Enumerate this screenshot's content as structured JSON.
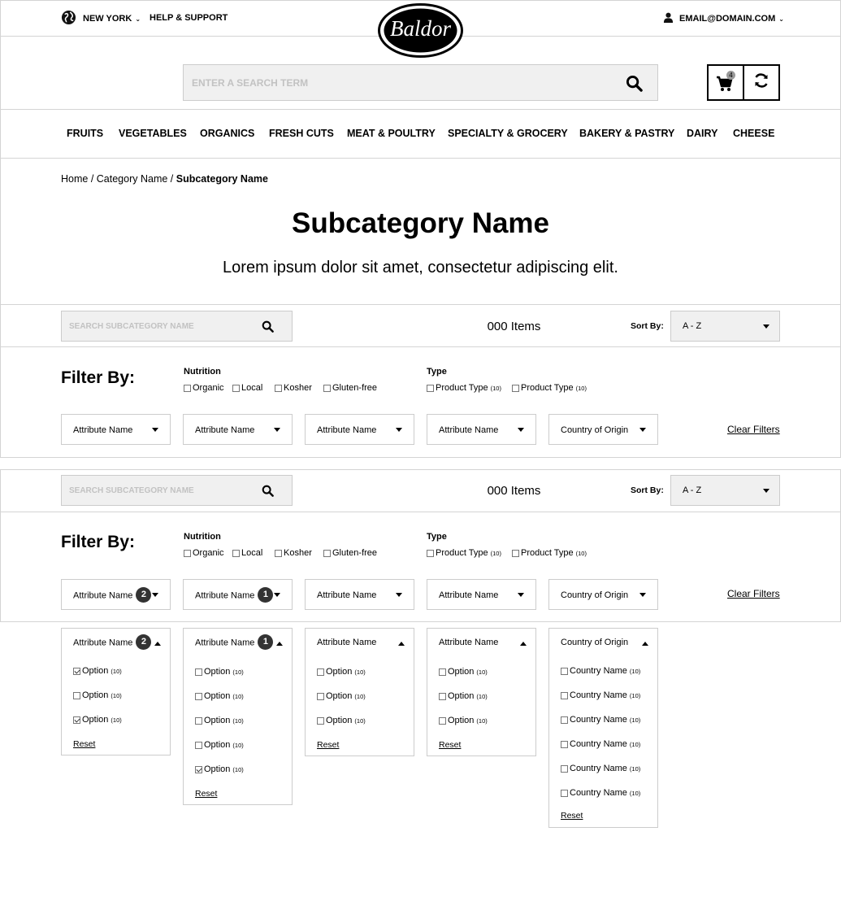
{
  "header": {
    "location": "NEW YORK",
    "help": "HELP & SUPPORT",
    "logo": "Baldor",
    "account": "EMAIL@DOMAIN.COM",
    "search_placeholder": "ENTER A SEARCH TERM",
    "cart_count": "4"
  },
  "nav": [
    "FRUITS",
    "VEGETABLES",
    "ORGANICS",
    "FRESH CUTS",
    "MEAT & POULTRY",
    "SPECIALTY & GROCERY",
    "BAKERY & PASTRY",
    "DAIRY",
    "CHEESE"
  ],
  "breadcrumb": {
    "home": "Home",
    "category": "Category Name",
    "current": "Subcategory Name",
    "sep": " / "
  },
  "page": {
    "title": "Subcategory Name",
    "subtitle": "Lorem ipsum dolor sit amet, consectetur adipiscing elit."
  },
  "toolbar": {
    "search_placeholder": "SEARCH SUBCATEGORY NAME",
    "items_count": "000 Items",
    "sort_label": "Sort By:",
    "sort_value": "A - Z"
  },
  "filters": {
    "title": "Filter By:",
    "nutrition_label": "Nutrition",
    "nutrition": [
      "Organic",
      "Local",
      "Kosher",
      "Gluten-free"
    ],
    "type_label": "Type",
    "types": [
      {
        "label": "Product Type",
        "count": "(10)"
      },
      {
        "label": "Product Type",
        "count": "(10)"
      }
    ],
    "clear": "Clear Filters",
    "selects": [
      "Attribute Name",
      "Attribute Name",
      "Attribute Name",
      "Attribute Name",
      "Country of Origin"
    ],
    "badges": [
      "2",
      "1"
    ]
  },
  "dropdowns": {
    "reset": "Reset",
    "option": "Option",
    "country": "Country Name",
    "count": "(10)",
    "col1": [
      true,
      false,
      true
    ],
    "col2": [
      false,
      false,
      false,
      false,
      true
    ]
  }
}
